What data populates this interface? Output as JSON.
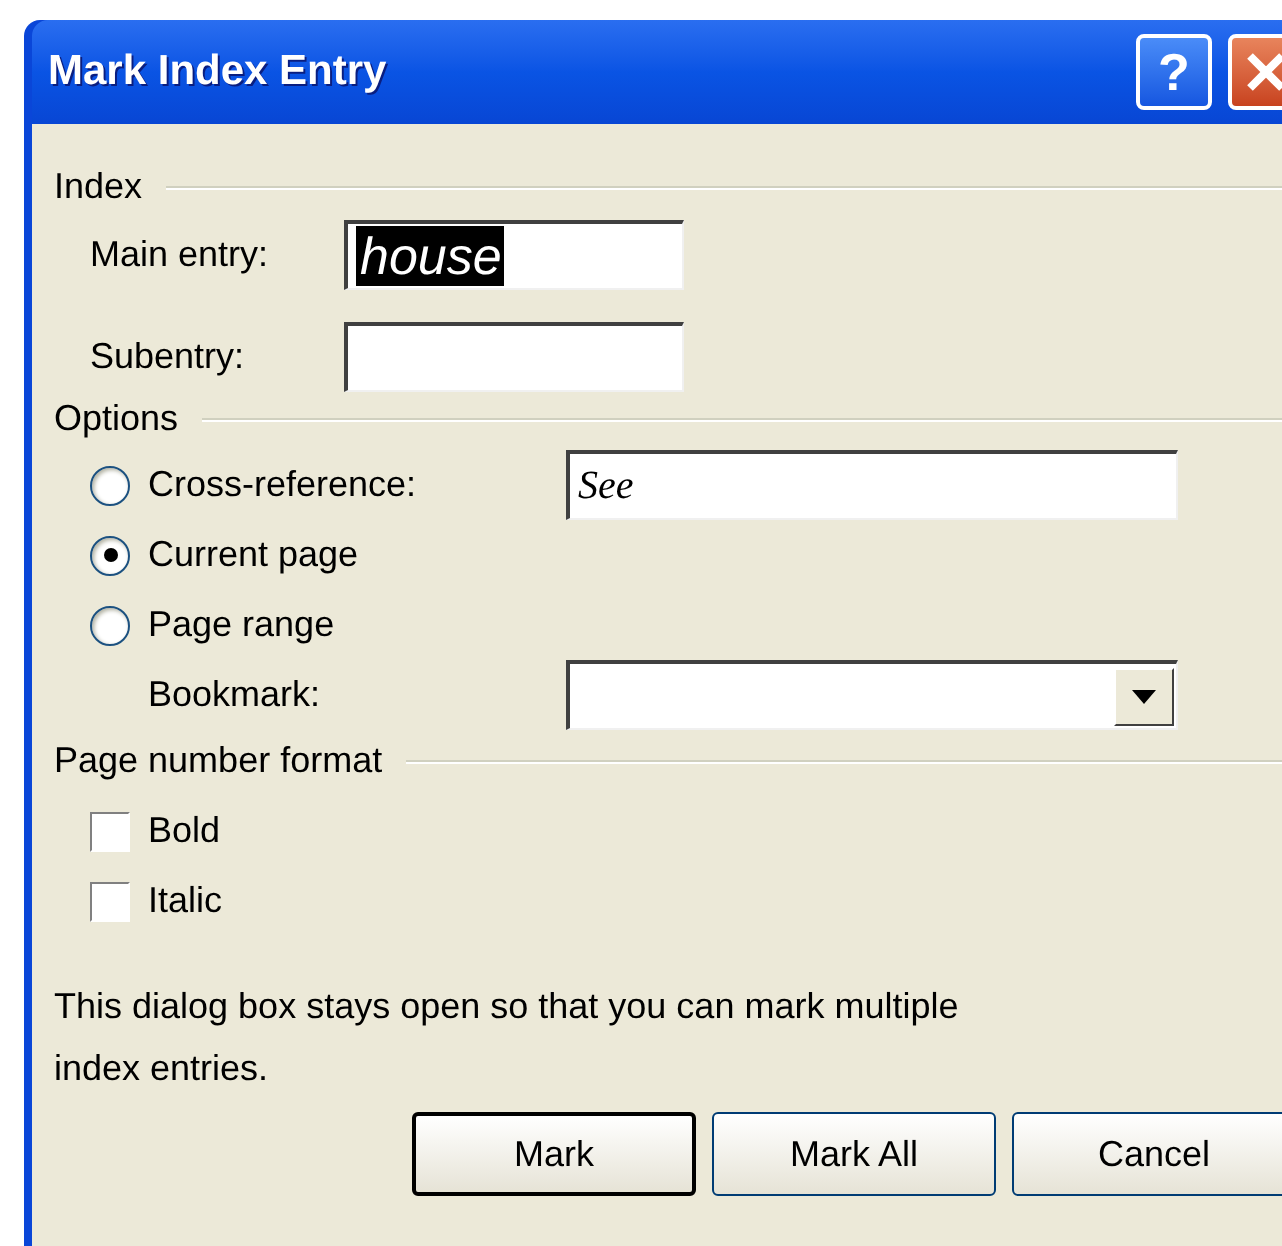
{
  "window": {
    "title": "Mark Index Entry"
  },
  "title_buttons": [
    {
      "kind": "help",
      "label": "?"
    },
    {
      "kind": "close"
    }
  ],
  "index": {
    "heading": "Index",
    "fields": [
      {
        "label": "Main entry:",
        "value": "house",
        "text_selected": true
      },
      {
        "label": "Subentry:"
      }
    ]
  },
  "options": {
    "heading": "Options",
    "radios": [
      {
        "label": "Cross-reference:",
        "selected": false,
        "field": {
          "kind": "text",
          "value": "See"
        }
      },
      {
        "label": "Current page",
        "selected": true
      },
      {
        "label": "Page range",
        "selected": false
      }
    ],
    "bookmark": {
      "label": "Bookmark:"
    }
  },
  "page_number_format": {
    "heading": "Page number format",
    "checkboxes": [
      {
        "label": "Bold",
        "checked": false
      },
      {
        "label": "Italic",
        "checked": false
      }
    ]
  },
  "note": "This dialog box stays open so that you can mark multiple index entries.",
  "buttons": [
    {
      "label": "Mark",
      "default": true
    },
    {
      "label": "Mark All",
      "default": false
    },
    {
      "label": "Cancel",
      "default": false
    }
  ]
}
